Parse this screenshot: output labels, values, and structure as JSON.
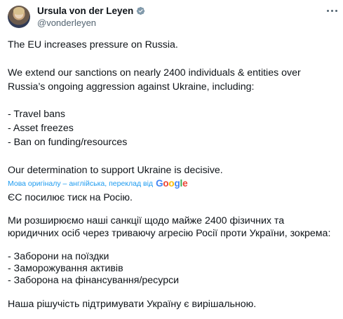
{
  "author": {
    "display_name": "Ursula von der Leyen",
    "handle": "@vonderleyen",
    "verified": true,
    "verified_color": "#829aab"
  },
  "original_text": [
    "The EU increases pressure on Russia.",
    "",
    "We extend our sanctions on nearly 2400 individuals & entities over",
    "Russia’s ongoing aggression against Ukraine, including:",
    "",
    "- Travel bans",
    "- Asset freezes",
    "- Ban on funding/resources",
    "",
    "Our determination to support Ukraine is decisive."
  ],
  "translation_notice": {
    "text": "Мова оригіналу – англійська, переклад від",
    "provider": "Google",
    "color": "#1d9bf0"
  },
  "translated_text": [
    "ЄС посилює тиск на Росію.",
    "",
    "Ми розширюємо наші санкції щодо майже 2400 фізичних та",
    "юридичних осіб через триваючу агресію Росії проти України, зокрема:",
    "",
    "- Заборони на поїздки",
    "- Заморожування активів",
    "- Заборона на фінансування/ресурси",
    "",
    "Наша рішучість підтримувати Україну є вирішальною."
  ],
  "icons": {
    "verified": "verified-badge-icon",
    "more": "more-options-icon",
    "google": "google-logo"
  }
}
